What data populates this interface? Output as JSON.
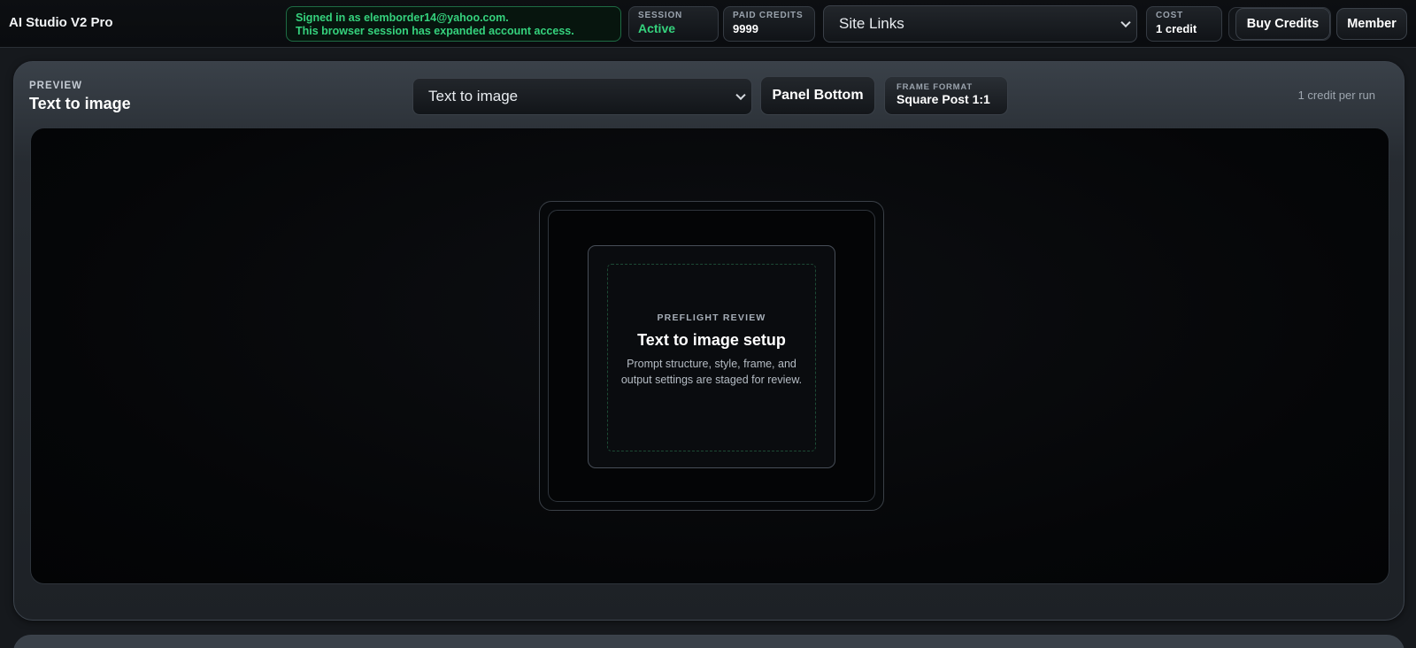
{
  "app": {
    "title": "AI Studio V2 Pro"
  },
  "account": {
    "signed_in_line": "Signed in as elemborder14@yahoo.com.",
    "access_line": "This browser session has expanded account access."
  },
  "session": {
    "label": "SESSION",
    "value": "Active"
  },
  "paid_credits": {
    "label": "PAID CREDITS",
    "value": "9999"
  },
  "site_links": {
    "selected": "Site Links"
  },
  "cost": {
    "label": "COST",
    "value": "1 credit"
  },
  "buttons": {
    "buy_credits": "Buy Credits",
    "member": "Member"
  },
  "preview": {
    "eyebrow": "PREVIEW",
    "title": "Text to image",
    "mode_selected": "Text to image",
    "panel_button": "Panel Bottom",
    "frame_format": {
      "label": "FRAME FORMAT",
      "value": "Square Post 1:1"
    },
    "rate_note": "1 credit per run",
    "preflight": {
      "eyebrow": "PREFLIGHT REVIEW",
      "title": "Text to image setup",
      "description": "Prompt structure, style, frame, and output settings are staged for review."
    }
  },
  "colors": {
    "accent_green": "#35d27d",
    "background": "#16191d",
    "panel": "#262b31"
  }
}
